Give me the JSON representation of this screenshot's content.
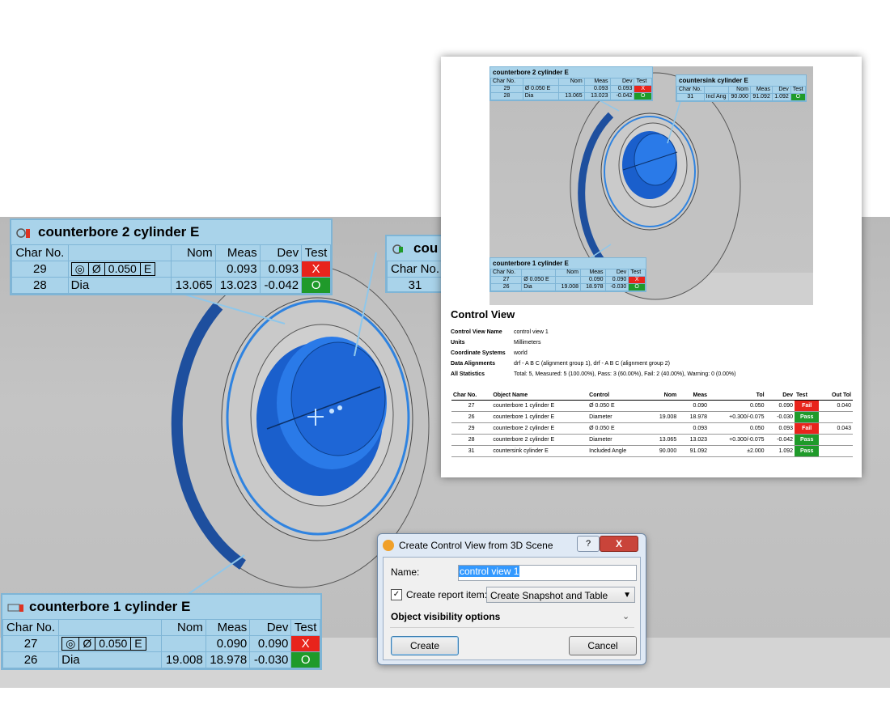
{
  "scene": {
    "annotation_top": {
      "title": "counterbore 2 cylinder E",
      "headers": [
        "Char No.",
        "",
        "Nom",
        "Meas",
        "Dev",
        "Test"
      ],
      "rows": [
        {
          "char": "29",
          "control": [
            "Ø",
            "0.050",
            "E"
          ],
          "nom": "",
          "meas": "0.093",
          "dev": "0.093",
          "test": "X",
          "status": "fail"
        },
        {
          "char": "28",
          "control": [
            "Dia"
          ],
          "nom": "13.065",
          "meas": "13.023",
          "dev": "-0.042",
          "test": "O",
          "status": "pass"
        }
      ]
    },
    "annotation_right": {
      "title": "cou",
      "header": "Char No.",
      "char": "31"
    },
    "annotation_bottom": {
      "title": "counterbore 1 cylinder E",
      "headers": [
        "Char No.",
        "",
        "Nom",
        "Meas",
        "Dev",
        "Test"
      ],
      "rows": [
        {
          "char": "27",
          "control": [
            "Ø",
            "0.050",
            "E"
          ],
          "nom": "",
          "meas": "0.090",
          "dev": "0.090",
          "test": "X",
          "status": "fail"
        },
        {
          "char": "26",
          "control": [
            "Dia"
          ],
          "nom": "19.008",
          "meas": "18.978",
          "dev": "-0.030",
          "test": "O",
          "status": "pass"
        }
      ]
    }
  },
  "report": {
    "mini_top": {
      "title": "counterbore 2 cylinder E",
      "headers": [
        "Char No.",
        "",
        "Nom",
        "Meas",
        "Dev",
        "Test"
      ],
      "rows": [
        {
          "char": "29",
          "control": "Ø 0.050 E",
          "nom": "",
          "meas": "0.093",
          "dev": "0.093",
          "test": "X"
        },
        {
          "char": "28",
          "control": "Dia",
          "nom": "13.065",
          "meas": "13.023",
          "dev": "-0.042",
          "test": "O"
        }
      ]
    },
    "mini_right": {
      "title": "countersink cylinder E",
      "headers": [
        "Char No.",
        "",
        "Nom",
        "Meas",
        "Dev",
        "Test"
      ],
      "row": {
        "char": "31",
        "control": "Incl Ang",
        "nom": "90.000",
        "meas": "91.092",
        "dev": "1.092",
        "test": "O"
      }
    },
    "mini_bottom": {
      "title": "counterbore 1 cylinder E",
      "headers": [
        "Char No.",
        "",
        "Nom",
        "Meas",
        "Dev",
        "Test"
      ],
      "rows": [
        {
          "char": "27",
          "control": "Ø 0.050 E",
          "nom": "",
          "meas": "0.090",
          "dev": "0.090",
          "test": "X"
        },
        {
          "char": "26",
          "control": "Dia",
          "nom": "19.008",
          "meas": "18.978",
          "dev": "-0.030",
          "test": "O"
        }
      ]
    },
    "section_title": "Control View",
    "info": [
      {
        "key": "Control View Name",
        "value": "control view 1"
      },
      {
        "key": "Units",
        "value": "Millimeters"
      },
      {
        "key": "Coordinate Systems",
        "value": "world"
      },
      {
        "key": "Data Alignments",
        "value": "drf - A B C (alignment group 1), drf - A B C (alignment group 2)"
      },
      {
        "key": "All Statistics",
        "value": "Total: 5, Measured: 5 (100.00%), Pass: 3 (60.00%), Fail: 2 (40.00%), Warning: 0 (0.00%)"
      }
    ],
    "table": {
      "headers": [
        "Char No.",
        "Object Name",
        "Control",
        "Nom",
        "Meas",
        "Tol",
        "Dev",
        "Test",
        "Out Tol"
      ],
      "rows": [
        {
          "char": "27",
          "object": "counterbore 1 cylinder E",
          "control": "Ø 0.050 E",
          "nom": "",
          "meas": "0.090",
          "tol": "0.050",
          "dev": "0.090",
          "test": "Fail",
          "out_tol": "0.040",
          "status": "fail"
        },
        {
          "char": "26",
          "object": "counterbore 1 cylinder E",
          "control": "Diameter",
          "nom": "19.008",
          "meas": "18.978",
          "tol": "+0.300/-0.075",
          "dev": "-0.030",
          "test": "Pass",
          "out_tol": "",
          "status": "pass"
        },
        {
          "char": "29",
          "object": "counterbore 2 cylinder E",
          "control": "Ø 0.050 E",
          "nom": "",
          "meas": "0.093",
          "tol": "0.050",
          "dev": "0.093",
          "test": "Fail",
          "out_tol": "0.043",
          "status": "fail"
        },
        {
          "char": "28",
          "object": "counterbore 2 cylinder E",
          "control": "Diameter",
          "nom": "13.065",
          "meas": "13.023",
          "tol": "+0.300/-0.075",
          "dev": "-0.042",
          "test": "Pass",
          "out_tol": "",
          "status": "pass"
        },
        {
          "char": "31",
          "object": "countersink cylinder E",
          "control": "Included Angle",
          "nom": "90.000",
          "meas": "91.092",
          "tol": "±2.000",
          "dev": "1.092",
          "test": "Pass",
          "out_tol": "",
          "status": "pass"
        }
      ]
    }
  },
  "dialog": {
    "title": "Create Control View from 3D Scene",
    "help_label": "?",
    "close_label": "X",
    "name_label": "Name:",
    "name_value": "control view 1",
    "report_checkbox_label": "Create report item:",
    "report_checked": true,
    "report_select_value": "Create Snapshot and Table",
    "visibility_label": "Object visibility options",
    "create_label": "Create",
    "cancel_label": "Cancel"
  },
  "colors": {
    "annotation_bg": "#a9d3ea",
    "fail": "#e8241c",
    "pass": "#1f9a2a",
    "part_blue": "#1a5fcc"
  }
}
